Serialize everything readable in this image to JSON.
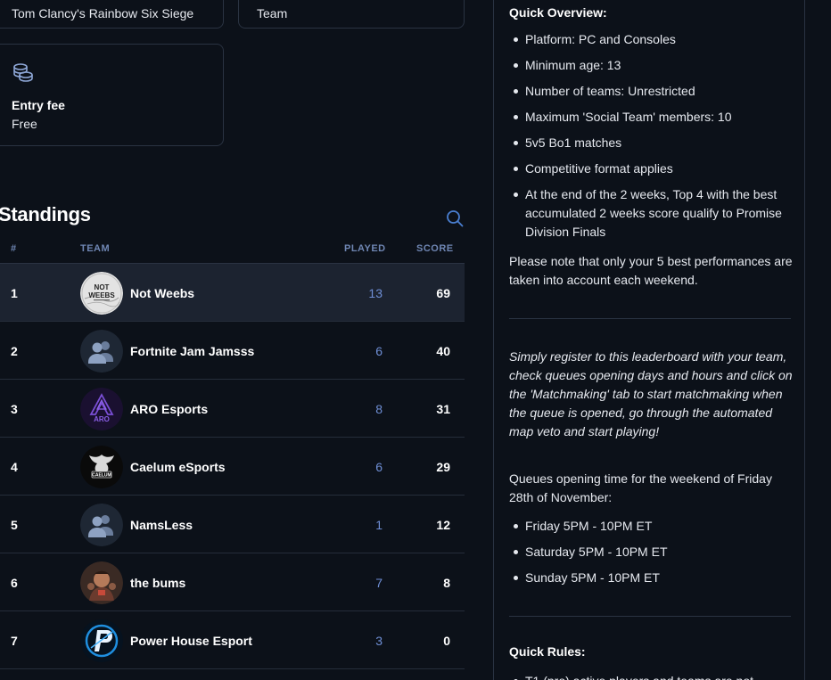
{
  "cards": {
    "game": "Tom Clancy's Rainbow Six Siege",
    "mode": "Team",
    "entry_fee_label": "Entry fee",
    "entry_fee_value": "Free"
  },
  "standings": {
    "title": "Standings",
    "columns": {
      "rank": "#",
      "team": "TEAM",
      "played": "PLAYED",
      "score": "SCORE"
    },
    "rows": [
      {
        "rank": "1",
        "team": "Not Weebs",
        "played": "13",
        "score": "69",
        "avatar": "not-weebs-logo"
      },
      {
        "rank": "2",
        "team": "Fortnite Jam Jamsss",
        "played": "6",
        "score": "40",
        "avatar": "default-team-icon"
      },
      {
        "rank": "3",
        "team": "ARO Esports",
        "played": "8",
        "score": "31",
        "avatar": "aro-logo"
      },
      {
        "rank": "4",
        "team": "Caelum eSports",
        "played": "6",
        "score": "29",
        "avatar": "caelum-logo"
      },
      {
        "rank": "5",
        "team": "NamsLess",
        "played": "1",
        "score": "12",
        "avatar": "default-team-icon"
      },
      {
        "rank": "6",
        "team": "the bums",
        "played": "7",
        "score": "8",
        "avatar": "the-bums-avatar"
      },
      {
        "rank": "7",
        "team": "Power House Esport",
        "played": "3",
        "score": "0",
        "avatar": "power-house-logo"
      }
    ]
  },
  "overview": {
    "heading": "Quick Overview:",
    "bullets": [
      "Platform: PC and Consoles",
      "Minimum age: 13",
      "Number of teams: Unrestricted",
      "Maximum 'Social Team' members: 10",
      "5v5 Bo1 matches",
      "Competitive format applies",
      "At the end of the 2 weeks, Top 4 with the best accumulated 2 weeks score qualify to Promise Division Finals"
    ],
    "note": "Please note that only your 5 best performances are taken into account each weekend.",
    "register_text": "Simply register to this leaderboard with your team, check queues opening days and hours and click on the 'Matchmaking' tab to start matchmaking when the queue is opened, go through the automated map veto and start playing!",
    "queues_intro": "Queues opening time for the weekend of Friday 28th of November:",
    "queue_times": [
      "Friday 5PM - 10PM ET",
      "Saturday 5PM - 10PM ET",
      "Sunday 5PM - 10PM ET"
    ],
    "rules_heading": "Quick Rules:",
    "rules_first": "T1 (pro) active players and teams are not"
  },
  "colors": {
    "background": "#0c1119",
    "highlight_row": "#1c2330",
    "accent_blue": "#6f8fd6",
    "border": "#2a3342"
  }
}
